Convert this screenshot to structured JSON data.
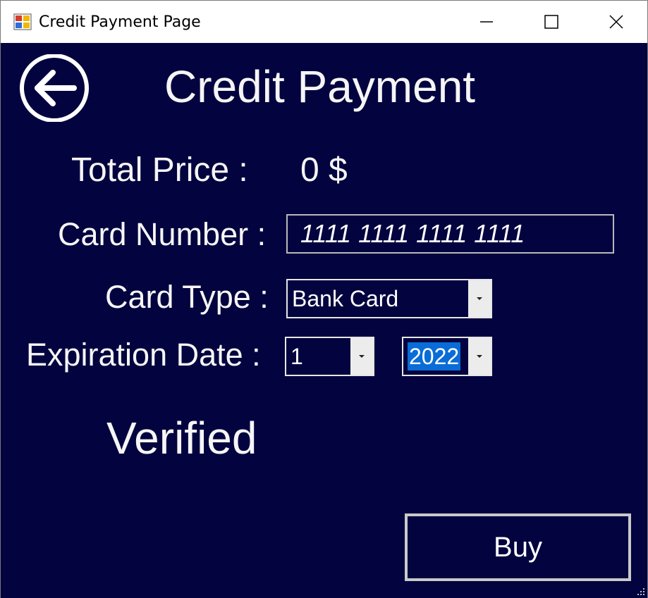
{
  "window": {
    "title": "Credit Payment Page"
  },
  "page": {
    "title": "Credit Payment",
    "back_icon": "back-arrow-circle-icon"
  },
  "total_price": {
    "label": "Total Price :",
    "value": "0 $"
  },
  "card_number": {
    "label": "Card Number :",
    "value": "1111 1111 1111 1111"
  },
  "card_type": {
    "label": "Card Type :",
    "selected": "Bank Card"
  },
  "expiration": {
    "label": "Expiration Date :",
    "month": "1",
    "year": "2022"
  },
  "status": {
    "text": "Verified"
  },
  "buy_button": {
    "label": "Buy"
  },
  "colors": {
    "background": "#03033f",
    "text": "#f5f5f5",
    "selection": "#0a6cd6"
  }
}
